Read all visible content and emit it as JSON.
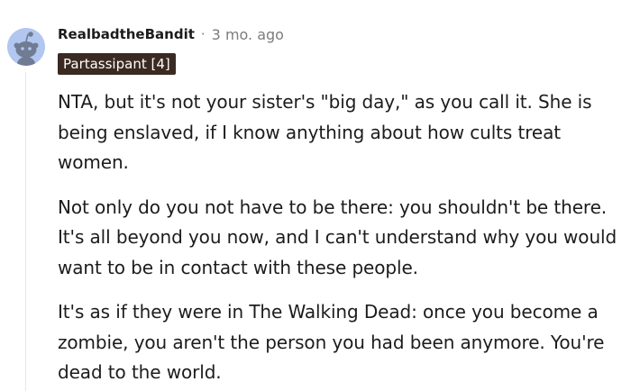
{
  "comment": {
    "author": "RealbadtheBandit",
    "separator": "·",
    "timestamp": "3 mo. ago",
    "flair": "Partassipant [4]",
    "paragraphs": [
      "NTA, but it's not your sister's \"big day,\" as you call it. She is being enslaved, if I know anything about how cults treat women.",
      "Not only do you not have to be there: you shouldn't be there. It's all beyond you now, and I can't understand why you would want to be in contact with these people.",
      "It's as if they were in The Walking Dead: once you become a zombie, you aren't the person you had been anymore. You're dead to the world."
    ]
  },
  "avatar": {
    "icon": "snoo-avatar-icon",
    "background_color": "#b2c7f0"
  },
  "colors": {
    "flair_background": "#3a2a22",
    "flair_text": "#ffffff",
    "meta_text": "#7c7c7c",
    "body_text": "#1c1c1c"
  }
}
